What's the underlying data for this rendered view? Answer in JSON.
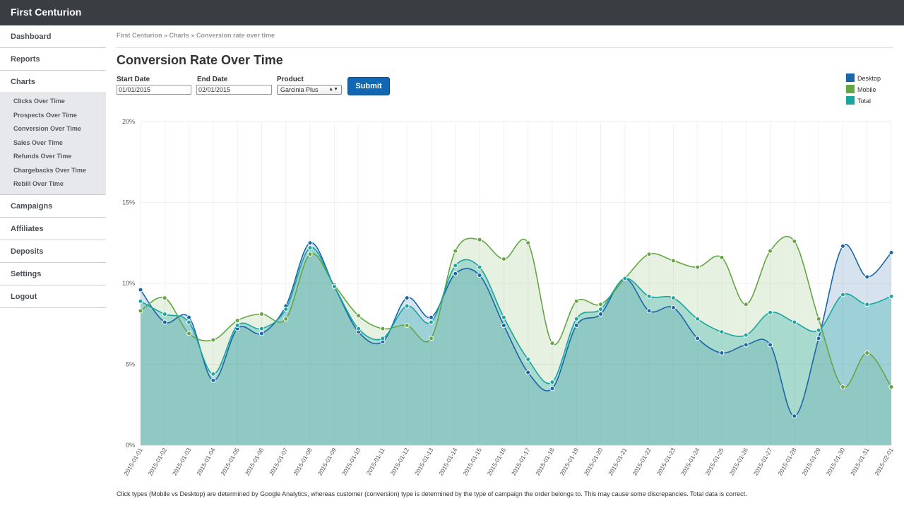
{
  "app": {
    "brand": "First Centurion"
  },
  "sidebar": {
    "items_top": [
      {
        "label": "Dashboard",
        "name": "dashboard"
      },
      {
        "label": "Reports",
        "name": "reports"
      },
      {
        "label": "Charts",
        "name": "charts"
      }
    ],
    "charts_sub": [
      {
        "label": "Clicks Over Time",
        "name": "clicks-over-time"
      },
      {
        "label": "Prospects Over Time",
        "name": "prospects-over-time"
      },
      {
        "label": "Conversion Over Time",
        "name": "conversion-over-time"
      },
      {
        "label": "Sales Over Time",
        "name": "sales-over-time"
      },
      {
        "label": "Refunds Over Time",
        "name": "refunds-over-time"
      },
      {
        "label": "Chargebacks Over Time",
        "name": "chargebacks-over-time"
      },
      {
        "label": "Rebill Over Time",
        "name": "rebill-over-time"
      }
    ],
    "items_bottom": [
      {
        "label": "Campaigns",
        "name": "campaigns"
      },
      {
        "label": "Affiliates",
        "name": "affiliates"
      },
      {
        "label": "Deposits",
        "name": "deposits"
      },
      {
        "label": "Settings",
        "name": "settings"
      },
      {
        "label": "Logout",
        "name": "logout"
      }
    ]
  },
  "breadcrumb": "First Centurion » Charts » Conversion rate over time",
  "page": {
    "title": "Conversion Rate Over Time"
  },
  "form": {
    "start_label": "Start Date",
    "start_value": "01/01/2015",
    "end_label": "End Date",
    "end_value": "02/01/2015",
    "product_label": "Product",
    "product_value": "Garcinia Plus",
    "submit_label": "Submit"
  },
  "colors": {
    "desktop": "#1a66a8",
    "mobile": "#64a544",
    "total": "#1aa5a0",
    "submit": "#1167b1"
  },
  "chart_data": {
    "type": "area",
    "x": [
      "2015-01-01",
      "2015-01-02",
      "2015-01-03",
      "2015-01-04",
      "2015-01-05",
      "2015-01-06",
      "2015-01-07",
      "2015-01-08",
      "2015-01-09",
      "2015-01-10",
      "2015-01-11",
      "2015-01-12",
      "2015-01-13",
      "2015-01-14",
      "2015-01-15",
      "2015-01-16",
      "2015-01-17",
      "2015-01-18",
      "2015-01-19",
      "2015-01-20",
      "2015-01-21",
      "2015-01-22",
      "2015-01-23",
      "2015-01-24",
      "2015-01-25",
      "2015-01-26",
      "2015-01-27",
      "2015-01-28",
      "2015-01-29",
      "2015-01-30",
      "2015-01-31",
      "2015-02-01"
    ],
    "y_ticks": [
      "0%",
      "5%",
      "10%",
      "15%",
      "20%"
    ],
    "ylim": [
      0,
      20
    ],
    "grid": true,
    "legend_position": "top-right",
    "series": [
      {
        "name": "Desktop",
        "color": "#1a66a8",
        "values": [
          9.6,
          7.6,
          7.9,
          4.0,
          7.2,
          6.9,
          8.6,
          12.5,
          9.8,
          7.0,
          6.4,
          9.1,
          7.9,
          10.6,
          10.5,
          7.4,
          4.5,
          3.5,
          7.4,
          8.1,
          10.3,
          8.3,
          8.5,
          6.6,
          5.7,
          6.2,
          6.2,
          1.8,
          6.6,
          12.3,
          10.4,
          11.9
        ]
      },
      {
        "name": "Mobile",
        "color": "#64a544",
        "values": [
          8.3,
          9.1,
          6.9,
          6.5,
          7.7,
          8.1,
          7.8,
          11.8,
          9.9,
          8.0,
          7.2,
          7.4,
          6.6,
          12.0,
          12.7,
          11.5,
          12.5,
          6.3,
          8.9,
          8.7,
          10.3,
          11.8,
          11.4,
          11.0,
          11.6,
          8.7,
          12.0,
          12.6,
          7.8,
          3.6,
          5.7,
          3.6
        ]
      },
      {
        "name": "Total",
        "color": "#1aa5a0",
        "values": [
          8.9,
          8.1,
          7.6,
          4.4,
          7.4,
          7.2,
          8.4,
          12.2,
          9.8,
          7.2,
          6.6,
          8.6,
          7.6,
          11.1,
          11.0,
          7.9,
          5.3,
          3.9,
          7.8,
          8.4,
          10.3,
          9.2,
          9.1,
          7.8,
          7.0,
          6.8,
          8.2,
          7.6,
          7.1,
          9.3,
          8.7,
          9.2
        ]
      }
    ]
  },
  "footnote": "Click types (Mobile vs Desktop) are determined by Google Analytics, whereas customer (conversion) type is determined by the type of campaign the order belongs to. This may cause some discrepancies. Total data is correct."
}
